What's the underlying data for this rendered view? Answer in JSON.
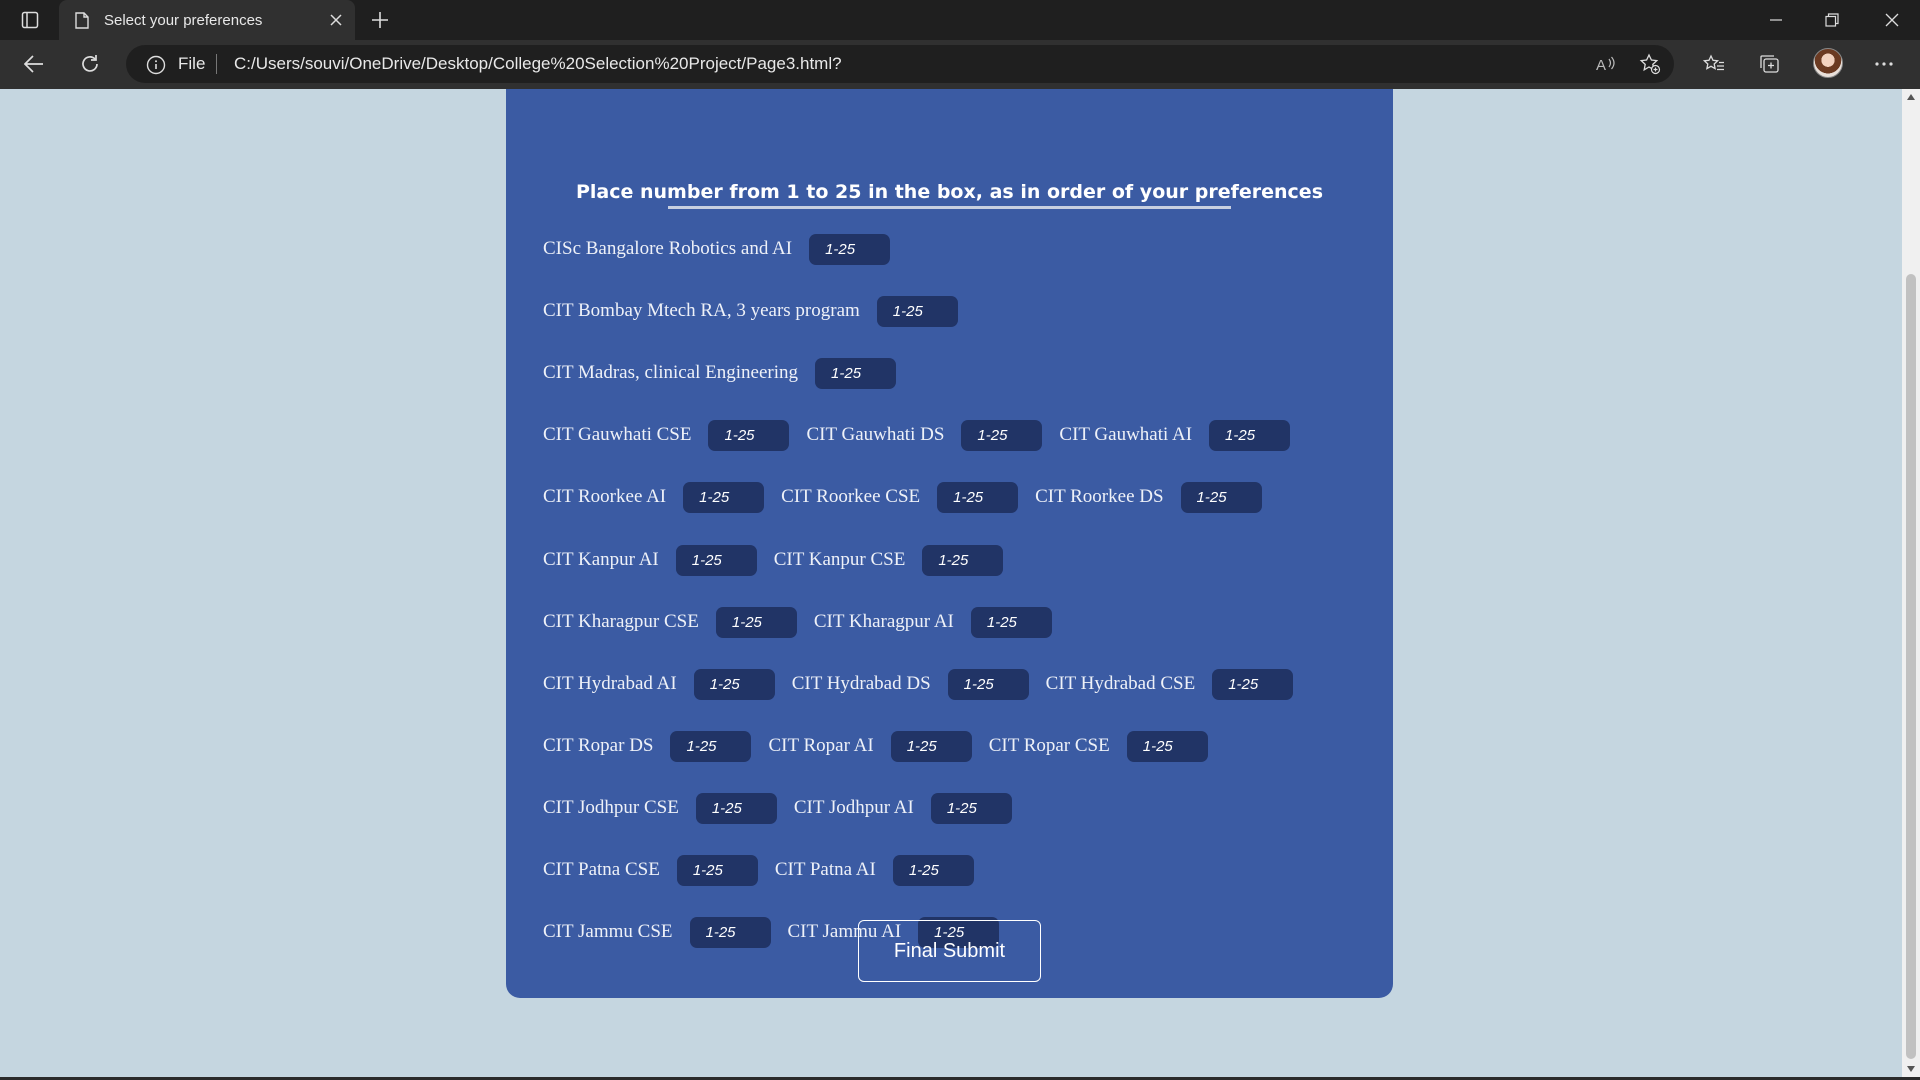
{
  "browser": {
    "tab_title": "Select your preferences",
    "address_prefix": "File",
    "url": "C:/Users/souvi/OneDrive/Desktop/College%20Selection%20Project/Page3.html?"
  },
  "page": {
    "heading": "Place number from 1 to 25 in the box, as in order of your preferences",
    "input_placeholder": "1-25",
    "submit_label": "Final Submit",
    "rows": [
      [
        "CISc Bangalore Robotics and AI"
      ],
      [
        "CIT Bombay Mtech RA, 3 years program"
      ],
      [
        "CIT Madras, clinical Engineering"
      ],
      [
        "CIT Gauwhati CSE",
        "CIT Gauwhati DS",
        "CIT Gauwhati AI"
      ],
      [
        "CIT Roorkee AI",
        "CIT Roorkee CSE",
        "CIT Roorkee DS"
      ],
      [
        "CIT Kanpur AI",
        "CIT Kanpur CSE"
      ],
      [
        "CIT Kharagpur CSE",
        "CIT Kharagpur AI"
      ],
      [
        "CIT Hydrabad AI",
        "CIT Hydrabad DS",
        "CIT Hydrabad CSE"
      ],
      [
        "CIT Ropar DS",
        "CIT Ropar AI",
        "CIT Ropar CSE"
      ],
      [
        "CIT Jodhpur CSE",
        "CIT Jodhpur AI"
      ],
      [
        "CIT Patna CSE",
        "CIT Patna AI"
      ],
      [
        "CIT Jammu CSE",
        "CIT Jammu AI"
      ]
    ]
  },
  "colors": {
    "panel": "#3b5ba3",
    "input_bg": "#213466",
    "page_bg": "#c5d6e0"
  }
}
